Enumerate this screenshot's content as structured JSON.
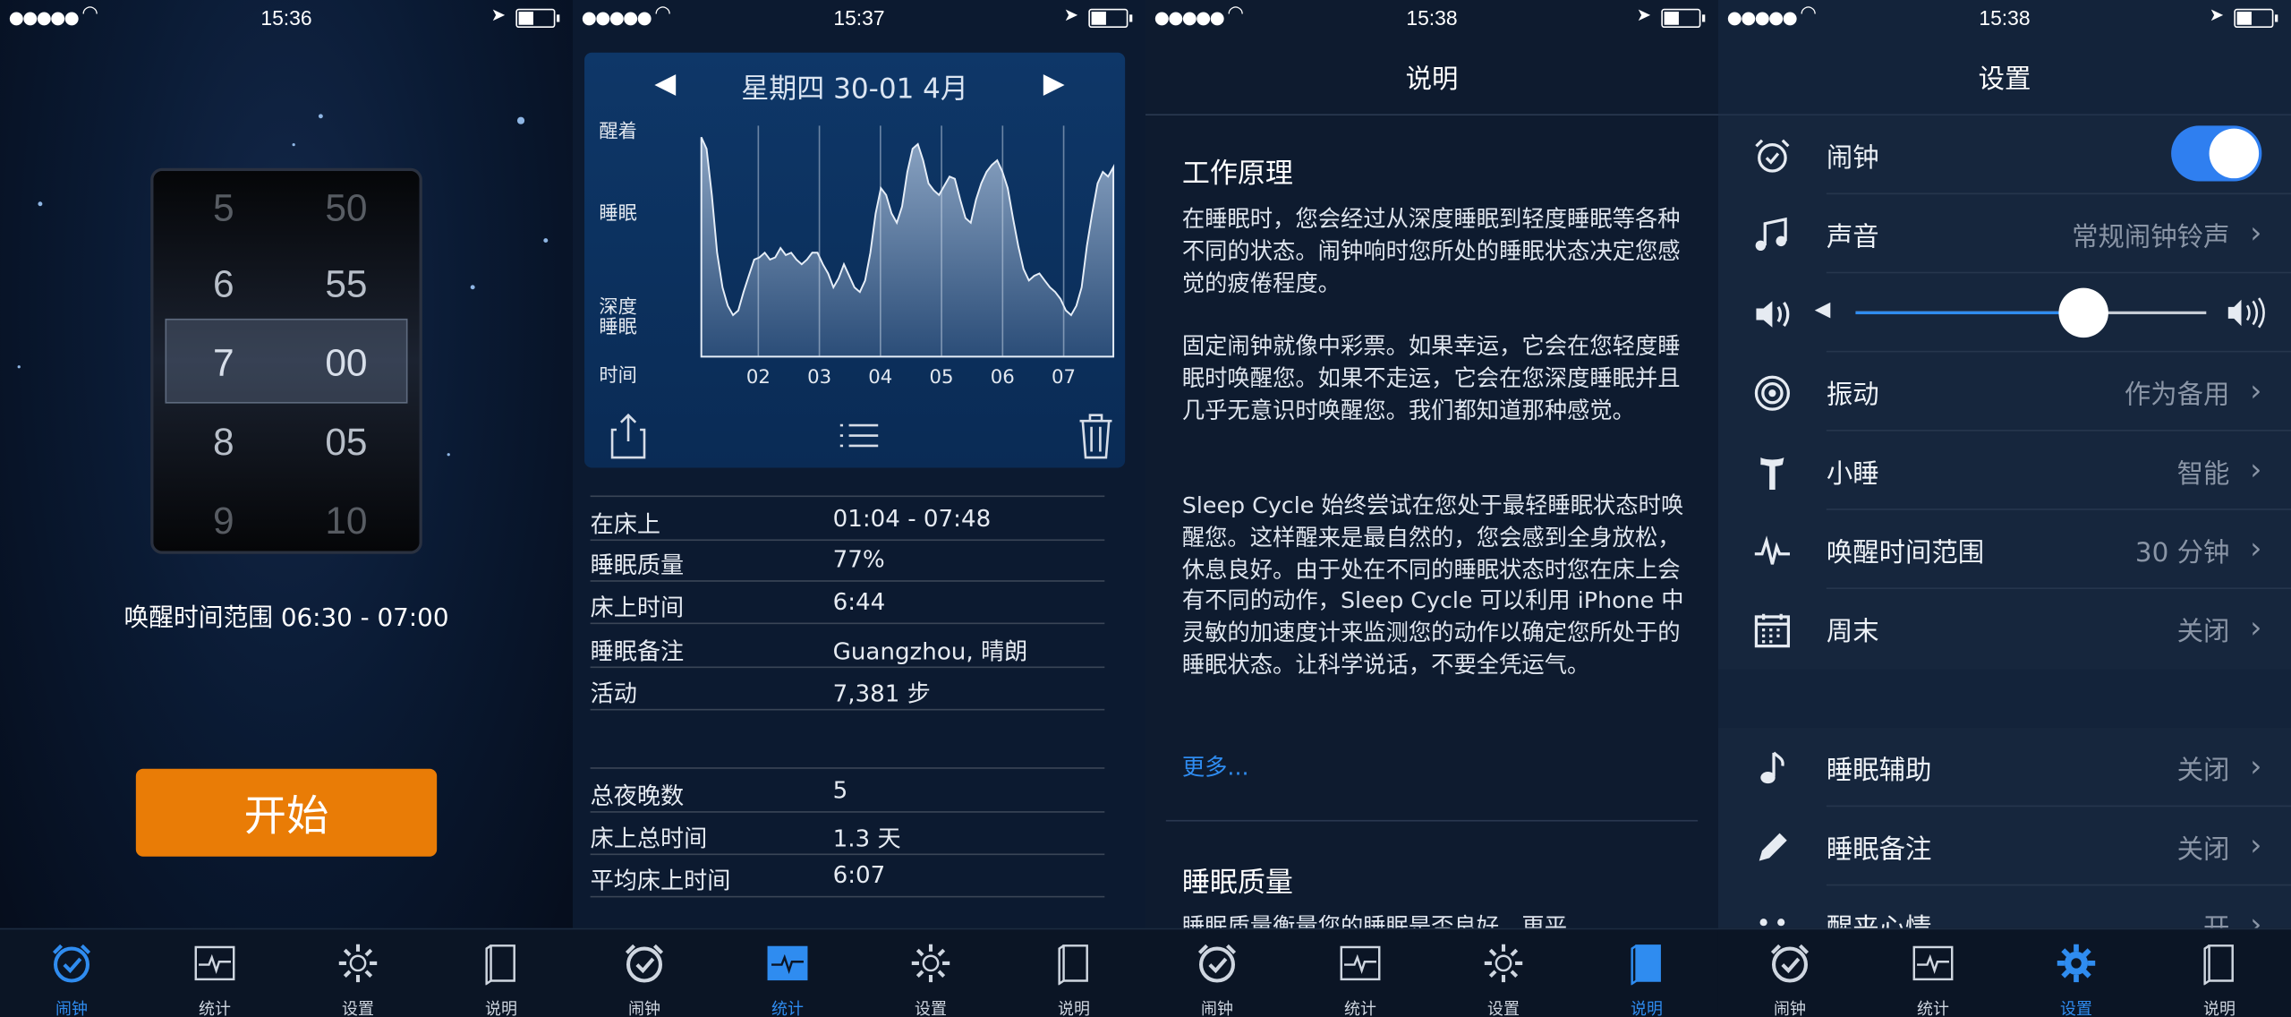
{
  "status": [
    {
      "time": "15:36"
    },
    {
      "time": "15:37"
    },
    {
      "time": "15:38"
    },
    {
      "time": "15:38"
    }
  ],
  "alarm": {
    "hours": [
      "5",
      "6",
      "7",
      "8",
      "9"
    ],
    "minutes": [
      "50",
      "55",
      "00",
      "05",
      "10"
    ],
    "wake_range": "唤醒时间范围 06:30 - 07:00",
    "start_label": "开始"
  },
  "stats": {
    "date_title": "星期四 30-01 4月",
    "y_labels": [
      "醒着",
      "睡眠",
      "深度\n睡眠",
      "时间"
    ],
    "x_labels": [
      "02",
      "03",
      "04",
      "05",
      "06",
      "07"
    ],
    "rows": [
      {
        "k": "在床上",
        "v": "01:04 - 07:48"
      },
      {
        "k": "睡眠质量",
        "v": "77%"
      },
      {
        "k": "床上时间",
        "v": "6:44"
      },
      {
        "k": "睡眠备注",
        "v": "Guangzhou, 晴朗"
      },
      {
        "k": "活动",
        "v": "7,381 步"
      }
    ],
    "rows2": [
      {
        "k": "总夜晚数",
        "v": "5"
      },
      {
        "k": "床上总时间",
        "v": "1.3 天"
      },
      {
        "k": "平均床上时间",
        "v": "6:07"
      }
    ]
  },
  "chart_data": {
    "type": "area",
    "title": "星期四 30-01 4月",
    "xlabel": "时间",
    "x_ticks": [
      "02",
      "03",
      "04",
      "05",
      "06",
      "07"
    ],
    "y_categories": [
      "深度睡眠",
      "睡眠",
      "醒着"
    ],
    "ylim": [
      0,
      1
    ],
    "series": [
      {
        "values": [
          0.95,
          0.9,
          0.7,
          0.45,
          0.3,
          0.22,
          0.18,
          0.2,
          0.28,
          0.35,
          0.42,
          0.43,
          0.45,
          0.42,
          0.43,
          0.47,
          0.44,
          0.45,
          0.42,
          0.4,
          0.42,
          0.45,
          0.45,
          0.4,
          0.36,
          0.3,
          0.34,
          0.4,
          0.35,
          0.3,
          0.28,
          0.33,
          0.45,
          0.62,
          0.73,
          0.7,
          0.62,
          0.58,
          0.65,
          0.8,
          0.9,
          0.92,
          0.85,
          0.75,
          0.72,
          0.7,
          0.74,
          0.78,
          0.77,
          0.68,
          0.6,
          0.58,
          0.68,
          0.75,
          0.8,
          0.83,
          0.85,
          0.8,
          0.73,
          0.6,
          0.48,
          0.38,
          0.33,
          0.35,
          0.36,
          0.33,
          0.3,
          0.28,
          0.25,
          0.2,
          0.18,
          0.22,
          0.3,
          0.48,
          0.62,
          0.75,
          0.8,
          0.78,
          0.82
        ]
      }
    ]
  },
  "about": {
    "nav_title": "说明",
    "heading1": "工作原理",
    "para1": "在睡眠时，您会经过从深度睡眠到轻度睡眠等各种不同的状态。闹钟响时您所处的睡眠状态决定您感觉的疲倦程度。",
    "para2": "固定闹钟就像中彩票。如果幸运，它会在您轻度睡眠时唤醒您。如果不走运，它会在您深度睡眠并且几乎无意识时唤醒您。我们都知道那种感觉。",
    "para3": "Sleep Cycle 始终尝试在您处于最轻睡眠状态时唤醒您。这样醒来是最自然的，您会感到全身放松，休息良好。由于处在不同的睡眠状态时您在床上会有不同的动作，Sleep Cycle 可以利用 iPhone 中灵敏的加速度计来监测您的动作以确定您所处于的睡眠状态。让科学说话，不要全凭运气。",
    "more": "更多...",
    "heading2": "睡眠质量",
    "para4": "睡眠质量衡量您的睡眠是否良好，更平"
  },
  "settings": {
    "nav_title": "设置",
    "rows": [
      {
        "label": "闹钟",
        "value": "",
        "icon": "alarm-clock-icon"
      },
      {
        "label": "声音",
        "value": "常规闹钟铃声",
        "icon": "music-note-icon"
      },
      {
        "label": "",
        "value": "",
        "icon": "volume-icon"
      },
      {
        "label": "振动",
        "value": "作为备用",
        "icon": "vibration-icon"
      },
      {
        "label": "小睡",
        "value": "智能",
        "icon": "snooze-icon"
      },
      {
        "label": "唤醒时间范围",
        "value": "30 分钟",
        "icon": "pulse-icon"
      },
      {
        "label": "周末",
        "value": "关闭",
        "icon": "calendar-icon"
      }
    ],
    "rows2": [
      {
        "label": "睡眠辅助",
        "value": "关闭",
        "icon": "note-icon"
      },
      {
        "label": "睡眠备注",
        "value": "关闭",
        "icon": "pencil-icon"
      },
      {
        "label": "醒来心情",
        "value": "开",
        "icon": "face-icon"
      }
    ],
    "alarm_enabled": true,
    "volume_level": 0.65
  },
  "tabs": [
    {
      "label": "闹钟",
      "icon": "alarm-clock-icon"
    },
    {
      "label": "统计",
      "icon": "chart-icon"
    },
    {
      "label": "设置",
      "icon": "gear-icon"
    },
    {
      "label": "说明",
      "icon": "book-icon"
    }
  ],
  "colors": {
    "accent": "#2f8cf0",
    "start_button": "#e97c06"
  }
}
